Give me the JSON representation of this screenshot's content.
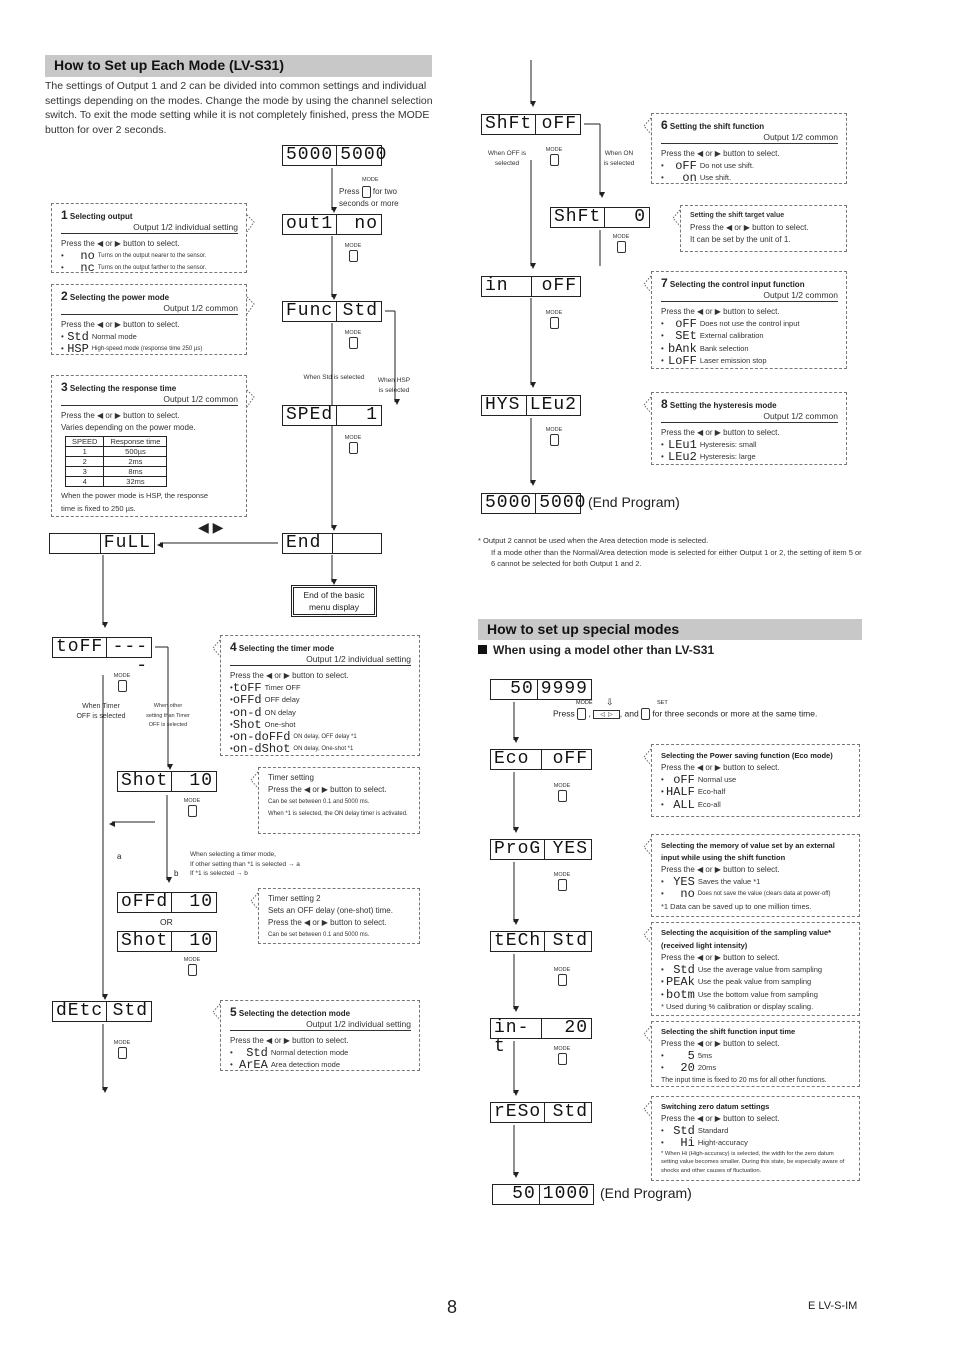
{
  "left": {
    "title": "How to Set up Each Mode (LV-S31)",
    "intro": "The settings of Output 1 and 2 can be divided into common settings and individual settings depending on the modes. Change the mode by using the channel selection switch. To exit the mode setting while it is not completely finished, press the MODE button for over 2 seconds.",
    "mode_label": "MODE",
    "press_mode": "Press",
    "press_mode_tail": "for two seconds or more",
    "displays": {
      "start": {
        "l": "5000",
        "r": "5000"
      },
      "out": {
        "l": "out1",
        "r": "no"
      },
      "func": {
        "l": "Func",
        "r": "Std"
      },
      "sped": {
        "l": "SPEd",
        "r": "1"
      },
      "end": {
        "l": "End",
        "r": ""
      },
      "full": {
        "l": "",
        "r": "FuLL"
      },
      "toff": {
        "l": "toFF",
        "r": "----"
      },
      "shot1": {
        "l": "Shot",
        "r": "10"
      },
      "offd": {
        "l": "oFFd",
        "r": "10"
      },
      "shot2": {
        "l": "Shot",
        "r": "10"
      },
      "detc": {
        "l": "dEtc",
        "r": "Std"
      }
    },
    "when_std": "When Std is selected",
    "when_hsp": "When HSP is selected",
    "arrows_lr": "◀ ▶",
    "end_note": "End of the basic menu display",
    "when_timer_off": "When Timer OFF is selected",
    "when_other": "When other setting than Timer OFF is selected",
    "timer_mode_note": [
      "When selecting a timer mode,",
      "If other setting than *1 is selected → a",
      "If *1 is selected → b"
    ],
    "label_a": "a",
    "label_b": "b",
    "or": "OR",
    "boxes": {
      "b1": {
        "num": "1",
        "title": "Selecting output",
        "scope": "Output 1/2 individual setting",
        "press": "Press the ◀ or ▶ button to select.",
        "opts": [
          {
            "code": "no",
            "desc": "Turns on the output nearer to the sensor."
          },
          {
            "code": "nc",
            "desc": "Turns on the output farther to the sensor."
          }
        ]
      },
      "b2": {
        "num": "2",
        "title": "Selecting the power mode",
        "scope": "Output 1/2 common",
        "press": "Press the ◀ or ▶ button to select.",
        "opts": [
          {
            "code": "Std",
            "desc": "Normal mode"
          },
          {
            "code": "HSP",
            "desc": "High-speed mode (response time 250 µs)"
          }
        ]
      },
      "b3": {
        "num": "3",
        "title": "Selecting the response time",
        "scope": "Output 1/2 common",
        "press": "Press the ◀ or ▶ button to select.",
        "varies": "Varies depending on the power mode.",
        "table_head": [
          "SPEED",
          "Response time"
        ],
        "table": [
          [
            "1",
            "500µs"
          ],
          [
            "2",
            "2ms"
          ],
          [
            "3",
            "8ms"
          ],
          [
            "4",
            "32ms"
          ]
        ],
        "note": "When the power mode is HSP, the response time is fixed to 250 µs."
      },
      "b4": {
        "num": "4",
        "title": "Selecting the timer mode",
        "scope": "Output 1/2 individual setting",
        "press": "Press the ◀ or ▶ button to select.",
        "opts": [
          {
            "code": "toFF",
            "desc": "Timer OFF"
          },
          {
            "code": "oFFd",
            "desc": "OFF delay"
          },
          {
            "code": "on-d",
            "desc": "ON delay"
          },
          {
            "code": "Shot",
            "desc": "One-shot"
          },
          {
            "code": "on-doFFd",
            "desc": "ON delay, OFF delay *1"
          },
          {
            "code": "on-dShot",
            "desc": "ON delay, One-shot *1"
          }
        ]
      },
      "timer": {
        "title": "Timer setting",
        "press": "Press the ◀ or ▶ button to select.",
        "l1": "Can be set between 0.1 and 5000 ms.",
        "l2": "When *1 is selected, the ON delay timer is activated."
      },
      "timer2": {
        "title": "Timer setting 2",
        "l0": "Sets an OFF delay (one-shot) time.",
        "press": "Press the ◀ or ▶ button to select.",
        "l1": "Can be set between 0.1 and 5000 ms."
      },
      "b5": {
        "num": "5",
        "title": "Selecting the detection mode",
        "scope": "Output 1/2 individual setting",
        "press": "Press the ◀ or ▶ button to select.",
        "opts": [
          {
            "code": "Std",
            "desc": "Normal detection mode"
          },
          {
            "code": "ArEA",
            "desc": "Area detection mode"
          }
        ]
      }
    }
  },
  "right": {
    "displays": {
      "shft": {
        "l": "ShFt",
        "r": "oFF"
      },
      "shft0": {
        "l": "ShFt",
        "r": "0"
      },
      "in": {
        "l": "in",
        "r": "oFF"
      },
      "hys": {
        "l": "HYS",
        "r": "LEu2"
      },
      "end": {
        "l": "5000",
        "r": "5000"
      }
    },
    "end_program": "(End Program)",
    "when_off": "When OFF is selected",
    "when_on": "When ON is selected",
    "boxes": {
      "b6": {
        "num": "6",
        "title": "Setting the shift function",
        "scope": "Output 1/2 common",
        "press": "Press the ◀ or ▶ button to select.",
        "opts": [
          {
            "code": "oFF",
            "desc": "Do not use shift."
          },
          {
            "code": "on",
            "desc": "Use shift."
          }
        ]
      },
      "target": {
        "title": "Setting the shift target value",
        "press": "Press the ◀ or ▶ button to select.",
        "l1": "It can be set by the unit of 1."
      },
      "b7": {
        "num": "7",
        "title": "Selecting the control input function",
        "scope": "Output 1/2 common",
        "press": "Press the ◀ or ▶ button to select.",
        "opts": [
          {
            "code": "oFF",
            "desc": "Does not use the control input"
          },
          {
            "code": "SEt",
            "desc": "External calibration"
          },
          {
            "code": "bAnk",
            "desc": "Bank selection"
          },
          {
            "code": "LoFF",
            "desc": "Laser emission stop"
          }
        ]
      },
      "b8": {
        "num": "8",
        "title": "Setting the hysteresis mode",
        "scope": "Output 1/2 common",
        "press": "Press the ◀ or ▶ button to select.",
        "opts": [
          {
            "code": "LEu1",
            "desc": "Hysteresis: small"
          },
          {
            "code": "LEu2",
            "desc": "Hysteresis: large"
          }
        ]
      }
    },
    "footnote": [
      "* Output 2 cannot be used when the Area detection mode is selected.",
      "If a mode other than the Normal/Area detection mode is selected for either Output 1 or 2, the setting of item 5 or 6 cannot be selected for both Output 1 and 2."
    ]
  },
  "special": {
    "title": "How to set up special modes",
    "subtitle": "When using a model other than LV-S31",
    "displays": {
      "start": {
        "l": "50",
        "r": "9999"
      },
      "eco": {
        "l": "Eco",
        "r": "oFF"
      },
      "prog": {
        "l": "ProG",
        "r": "YES"
      },
      "tech": {
        "l": "tECh",
        "r": "Std"
      },
      "int": {
        "l": "in-t",
        "r": "20"
      },
      "reso": {
        "l": "rESo",
        "r": "Std"
      },
      "end": {
        "l": "50",
        "r": "1000"
      }
    },
    "press": "Press",
    "set_label": "SET",
    "press_tail": ", and",
    "press_end": "for three seconds or more at the same time.",
    "end_program": "(End Program)",
    "boxes": {
      "eco": {
        "title": "Selecting the Power saving function (Eco mode)",
        "press": "Press the ◀ or ▶ button to select.",
        "opts": [
          {
            "code": "oFF",
            "desc": "Normal use"
          },
          {
            "code": "HALF",
            "desc": "Eco-half"
          },
          {
            "code": "ALL",
            "desc": "Eco-all"
          }
        ]
      },
      "mem": {
        "title": "Selecting the memory of value set by an external input while using the shift function",
        "press": "Press the ◀ or ▶ button to select.",
        "opts": [
          {
            "code": "YES",
            "desc": "Saves the value *1"
          },
          {
            "code": "no",
            "desc": "Does not save the value (clears data at power-off)"
          }
        ],
        "note": "*1 Data can be saved up to one million times."
      },
      "samp": {
        "title": "Selecting the acquisition of the sampling value* (received light intensity)",
        "press": "Press the ◀ or ▶ button to select.",
        "opts": [
          {
            "code": "Std",
            "desc": "Use the average value from sampling"
          },
          {
            "code": "PEAk",
            "desc": "Use the peak value from sampling"
          },
          {
            "code": "botm",
            "desc": "Use the bottom value from sampling"
          }
        ],
        "note": "* Used during % calibration or display scaling."
      },
      "inp": {
        "title": "Selecting the shift function input time",
        "press": "Press the ◀ or ▶ button to select.",
        "opts": [
          {
            "code": "5",
            "desc": "5ms"
          },
          {
            "code": "20",
            "desc": "20ms"
          }
        ],
        "note": "The input time is fixed to 20 ms for all other functions."
      },
      "zero": {
        "title": "Switching zero datum settings",
        "press": "Press the ◀ or ▶ button to select.",
        "opts": [
          {
            "code": "Std",
            "desc": "Standard"
          },
          {
            "code": "Hi",
            "desc": "Hight-accuracy"
          }
        ],
        "note": "* When Hi (High-accuracy) is selected, the width for the zero datum setting value becomes smaller. During this state, be especially aware of shocks and other causes of fluctuation."
      }
    }
  },
  "footer": {
    "page": "8",
    "code": "E LV-S-IM"
  }
}
